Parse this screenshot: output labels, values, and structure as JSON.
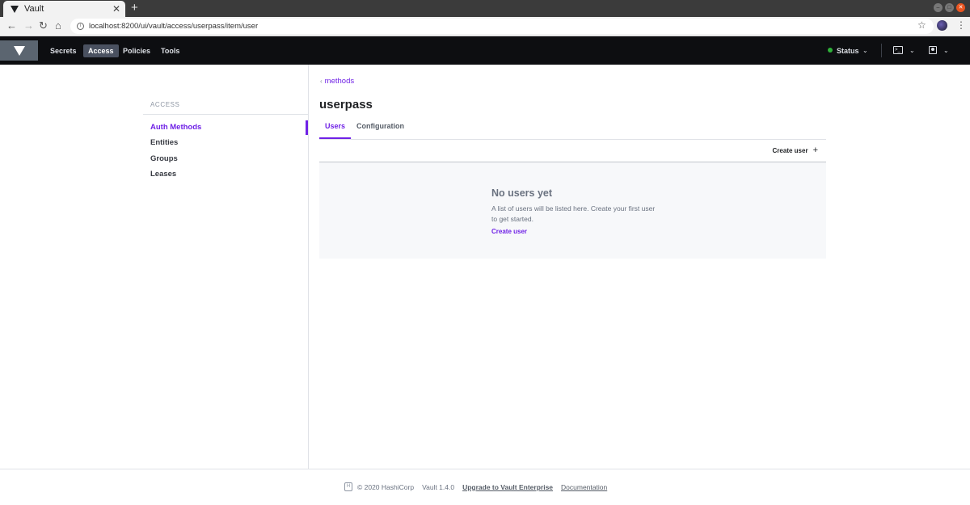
{
  "browser": {
    "tab_title": "Vault",
    "tab_close": "✕",
    "new_tab": "+",
    "url": "localhost:8200/ui/vault/access/userpass/item/user"
  },
  "header": {
    "nav": [
      {
        "label": "Secrets"
      },
      {
        "label": "Access"
      },
      {
        "label": "Policies"
      },
      {
        "label": "Tools"
      }
    ],
    "status_label": "Status",
    "status_color": "#2eb039"
  },
  "sidebar": {
    "section": "ACCESS",
    "items": [
      {
        "label": "Auth Methods"
      },
      {
        "label": "Entities"
      },
      {
        "label": "Groups"
      },
      {
        "label": "Leases"
      }
    ]
  },
  "main": {
    "breadcrumb": "methods",
    "title": "userpass",
    "tabs": [
      {
        "label": "Users"
      },
      {
        "label": "Configuration"
      }
    ],
    "create_user_label": "Create user",
    "empty": {
      "title": "No users yet",
      "message": "A list of users will be listed here. Create your first user to get started.",
      "link": "Create user"
    }
  },
  "footer": {
    "copyright": "© 2020 HashiCorp",
    "version": "Vault 1.4.0",
    "upgrade_link": "Upgrade to Vault Enterprise",
    "docs_link": "Documentation"
  },
  "colors": {
    "accent": "#6f21e6",
    "header_bg": "#0d0e11"
  }
}
